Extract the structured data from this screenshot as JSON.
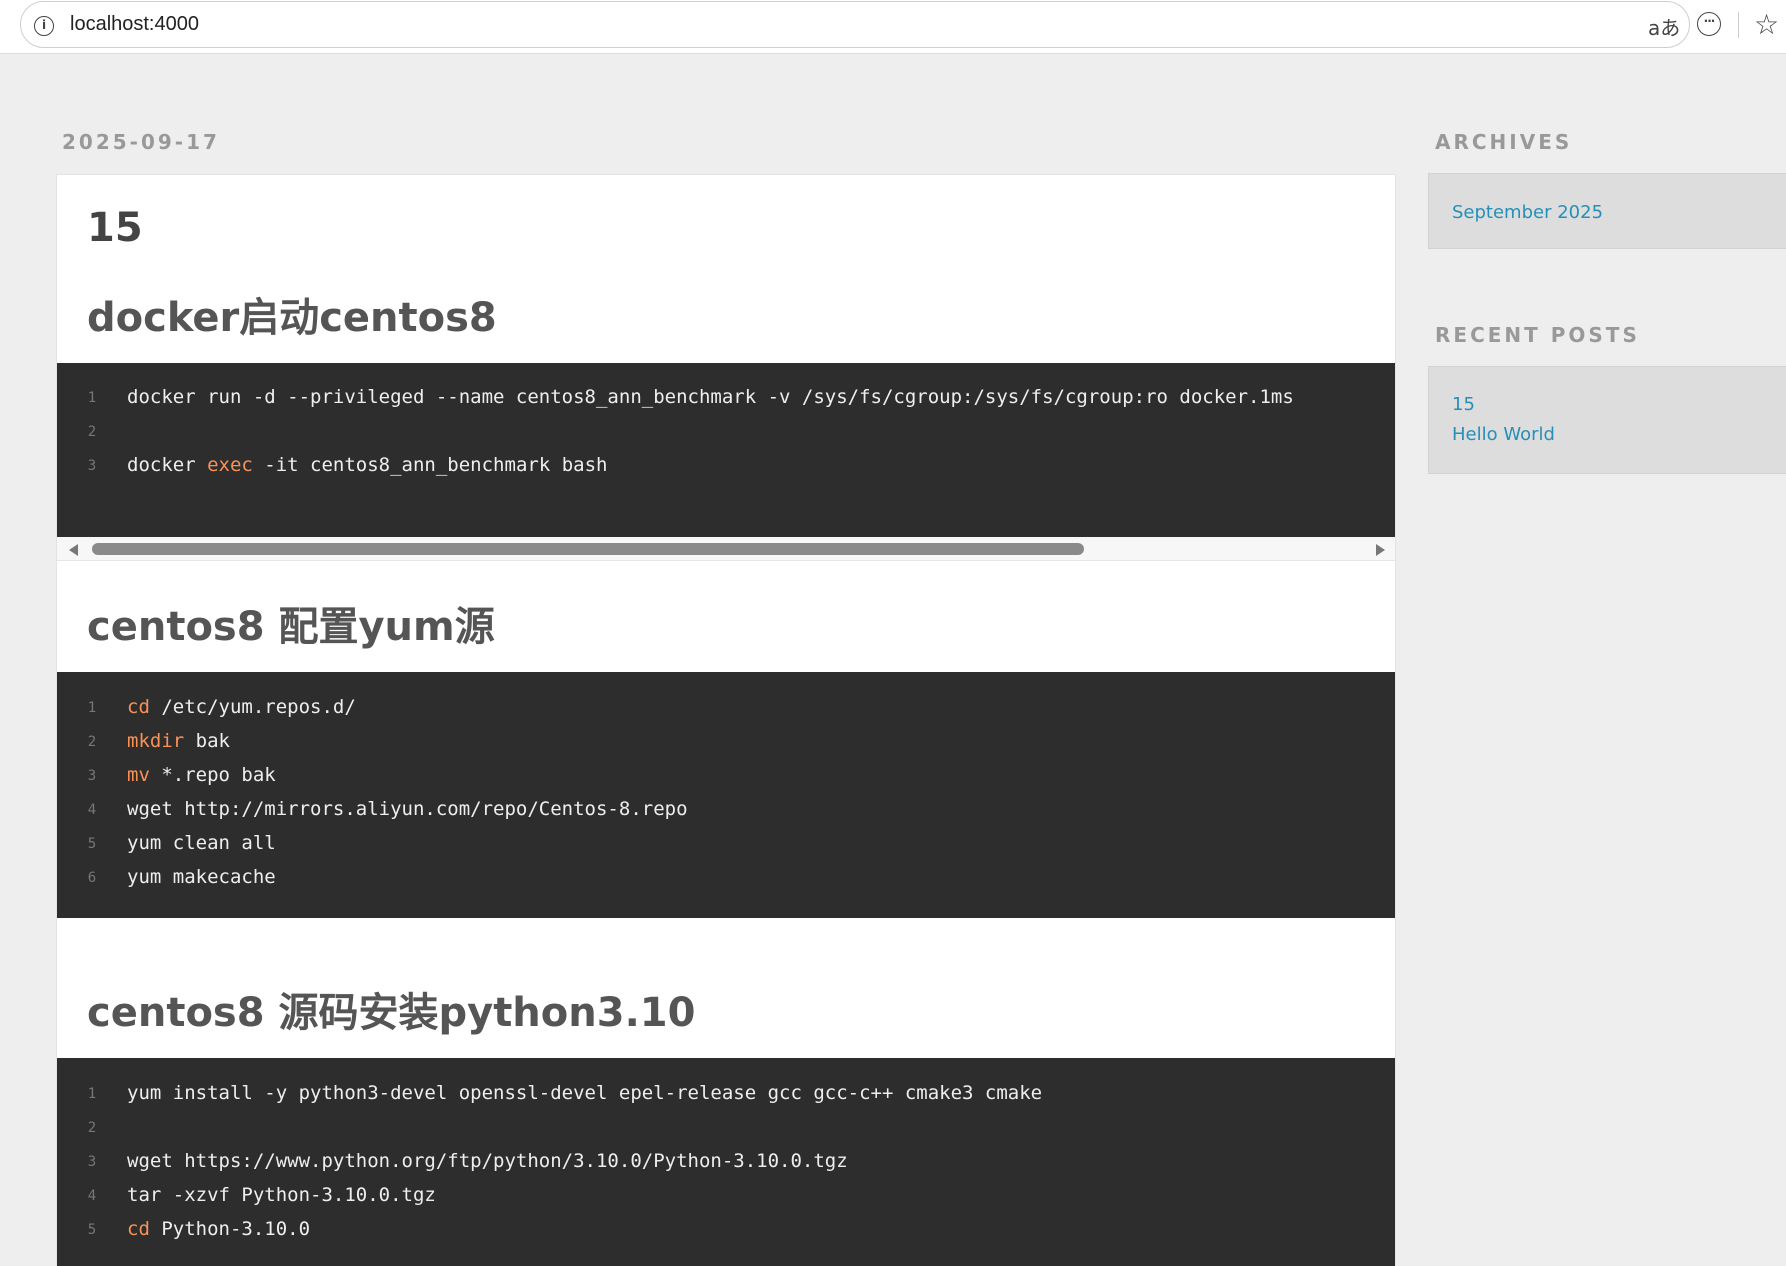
{
  "browser": {
    "url": "localhost:4000",
    "icons": [
      "info-icon",
      "translate-icon",
      "more-icon",
      "star-icon"
    ],
    "translate_glyph": "aあ",
    "more_glyph": "···",
    "star_glyph": "☆",
    "info_glyph": "i"
  },
  "post": {
    "date": "2025-09-17",
    "title": "15",
    "sections": [
      {
        "heading": "docker启动centos8",
        "lines": [
          [
            {
              "t": "docker run -d   --privileged   --name centos8_ann_benchmark   -v /sys/fs/cgroup:/sys/fs/cgroup:ro   docker.1ms"
            }
          ],
          [],
          [
            {
              "t": "docker "
            },
            {
              "t": "exec",
              "k": 1
            },
            {
              "t": " -it centos8_ann_benchmark bash"
            }
          ]
        ],
        "scrollable": true
      },
      {
        "heading": "centos8 配置yum源",
        "lines": [
          [
            {
              "t": "cd",
              "k": 1
            },
            {
              "t": " /etc/yum.repos.d/"
            }
          ],
          [
            {
              "t": "mkdir",
              "k": 1
            },
            {
              "t": " bak"
            }
          ],
          [
            {
              "t": "mv",
              "k": 1
            },
            {
              "t": " *.repo bak"
            }
          ],
          [
            {
              "t": "wget http://mirrors.aliyun.com/repo/Centos-8.repo"
            }
          ],
          [
            {
              "t": "yum clean all"
            }
          ],
          [
            {
              "t": "yum makecache"
            }
          ]
        ]
      },
      {
        "heading": "centos8 源码安装python3.10",
        "lines": [
          [
            {
              "t": "yum install -y python3-devel openssl-devel epel-release gcc gcc-c++ cmake3 cmake"
            }
          ],
          [],
          [
            {
              "t": "wget https://www.python.org/ftp/python/3.10.0/Python-3.10.0.tgz"
            }
          ],
          [
            {
              "t": "tar -xzvf Python-3.10.0.tgz"
            }
          ],
          [
            {
              "t": "cd",
              "k": 1
            },
            {
              "t": " Python-3.10.0"
            }
          ]
        ]
      }
    ]
  },
  "sidebar": {
    "archives_heading": "ARCHIVES",
    "archives": [
      "September 2025"
    ],
    "recent_heading": "RECENT POSTS",
    "recent": [
      "15",
      "Hello World"
    ]
  },
  "colors": {
    "link": "#258fb8",
    "code_bg": "#2d2d2d",
    "code_keyword": "#f99157",
    "code_text": "#eeeeee",
    "page_bg": "#eeeeee"
  }
}
